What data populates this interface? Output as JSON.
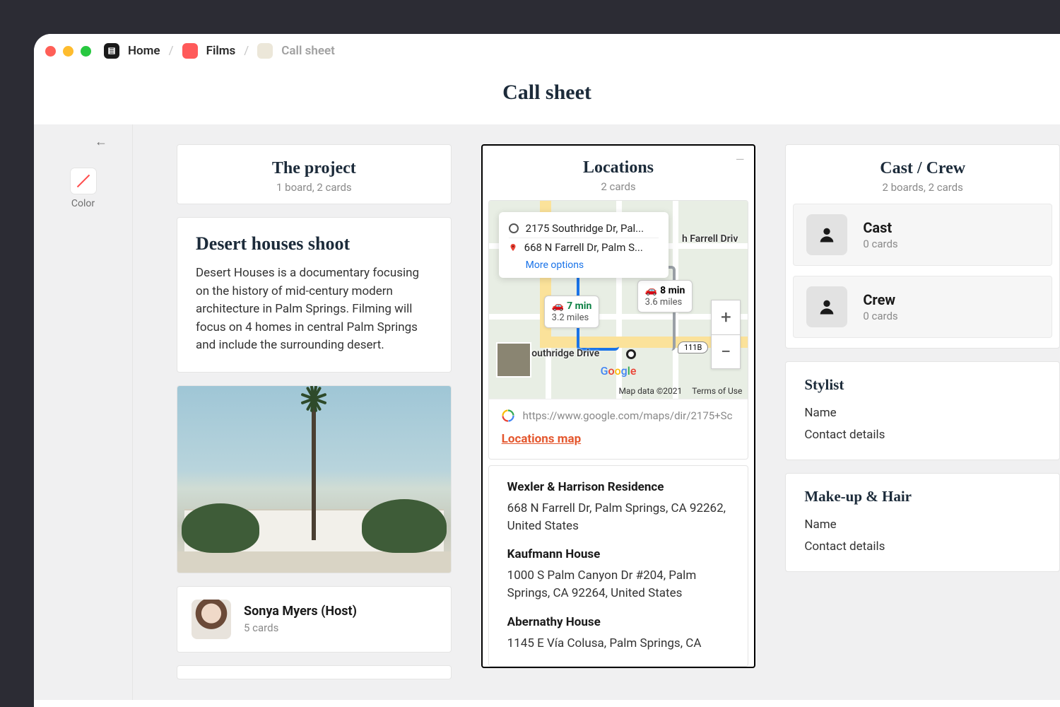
{
  "breadcrumb": {
    "home": "Home",
    "films": "Films",
    "sheet": "Call sheet"
  },
  "page_title": "Call sheet",
  "sidebar": {
    "color_label": "Color"
  },
  "project_col": {
    "title": "The project",
    "subtitle": "1 board, 2 cards",
    "card_title": "Desert houses shoot",
    "description": "Desert Houses is a documentary focusing on the history of mid-century modern architecture in Palm Springs. Filming will focus on 4 homes in central Palm Springs and include the surrounding desert.",
    "person": {
      "name": "Sonya Myers (Host)",
      "sub": "5 cards"
    }
  },
  "locations_col": {
    "title": "Locations",
    "subtitle": "2 cards",
    "route_origin": "2175 Southridge Dr, Pal...",
    "route_dest": "668 N Farrell Dr, Palm S...",
    "more_options": "More options",
    "badge1_time": "7 min",
    "badge1_dist": "3.2 miles",
    "badge2_time": "8 min",
    "badge2_dist": "3.6 miles",
    "farrell_label": "h Farrell Driv",
    "southridge_label": "Southridge Drive",
    "shield": "111B",
    "map_data": "Map data ©2021",
    "terms": "Terms of Use",
    "map_url": "https://www.google.com/maps/dir/2175+Sc",
    "map_link": "Locations map",
    "loc1_name": "Wexler & Harrison Residence",
    "loc1_addr": "668 N Farrell Dr, Palm Springs, CA 92262, United States",
    "loc2_name": "Kaufmann House",
    "loc2_addr": "1000 S Palm Canyon Dr #204, Palm Springs, CA 92264, United States",
    "loc3_name": "Abernathy House",
    "loc3_addr": "1145 E Vía Colusa, Palm Springs, CA"
  },
  "crew_col": {
    "title": "Cast / Crew",
    "subtitle": "2 boards, 2 cards",
    "cast_title": "Cast",
    "cast_sub": "0 cards",
    "crew_title": "Crew",
    "crew_sub": "0 cards",
    "stylist_title": "Stylist",
    "stylist_name": "Name",
    "stylist_contact": "Contact details",
    "makeup_title": "Make-up & Hair",
    "makeup_name": "Name",
    "makeup_contact": "Contact details"
  }
}
